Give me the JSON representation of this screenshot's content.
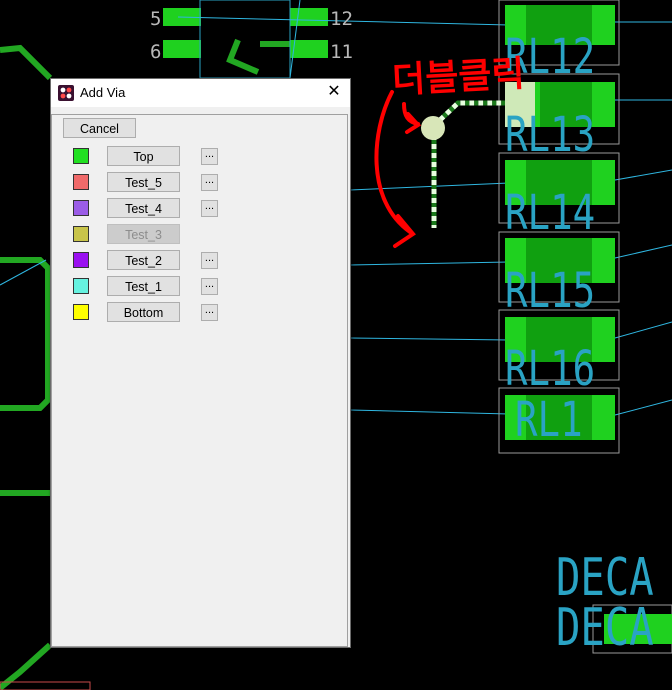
{
  "dialog": {
    "title": "Add Via",
    "close_glyph": "✕",
    "cancel_label": "Cancel",
    "dots_label": "...",
    "layers": [
      {
        "name": "Top",
        "color": "#22e022",
        "enabled": true,
        "has_dots": true
      },
      {
        "name": "Test_5",
        "color": "#f06a6a",
        "enabled": true,
        "has_dots": true
      },
      {
        "name": "Test_4",
        "color": "#9a5ce6",
        "enabled": true,
        "has_dots": true
      },
      {
        "name": "Test_3",
        "color": "#c8c44a",
        "enabled": false,
        "has_dots": false
      },
      {
        "name": "Test_2",
        "color": "#9a10f0",
        "enabled": true,
        "has_dots": true
      },
      {
        "name": "Test_1",
        "color": "#66f2e0",
        "enabled": true,
        "has_dots": true
      },
      {
        "name": "Bottom",
        "color": "#ffff00",
        "enabled": true,
        "has_dots": true
      }
    ]
  },
  "pcb": {
    "pin_labels": [
      "5",
      "6",
      "12",
      "11"
    ],
    "component_labels": [
      "RL12",
      "RL13",
      "RL14",
      "RL15",
      "RL16",
      "RL1"
    ],
    "decal_labels": [
      "DECA",
      "DECA"
    ],
    "annotation_text": "더블클릭",
    "colors": {
      "copper": "#22a722",
      "pad": "#1fd11f",
      "silk": "#2aa3c4",
      "ratsnest": "#2fb6e0",
      "annotation": "#ff0000"
    }
  }
}
